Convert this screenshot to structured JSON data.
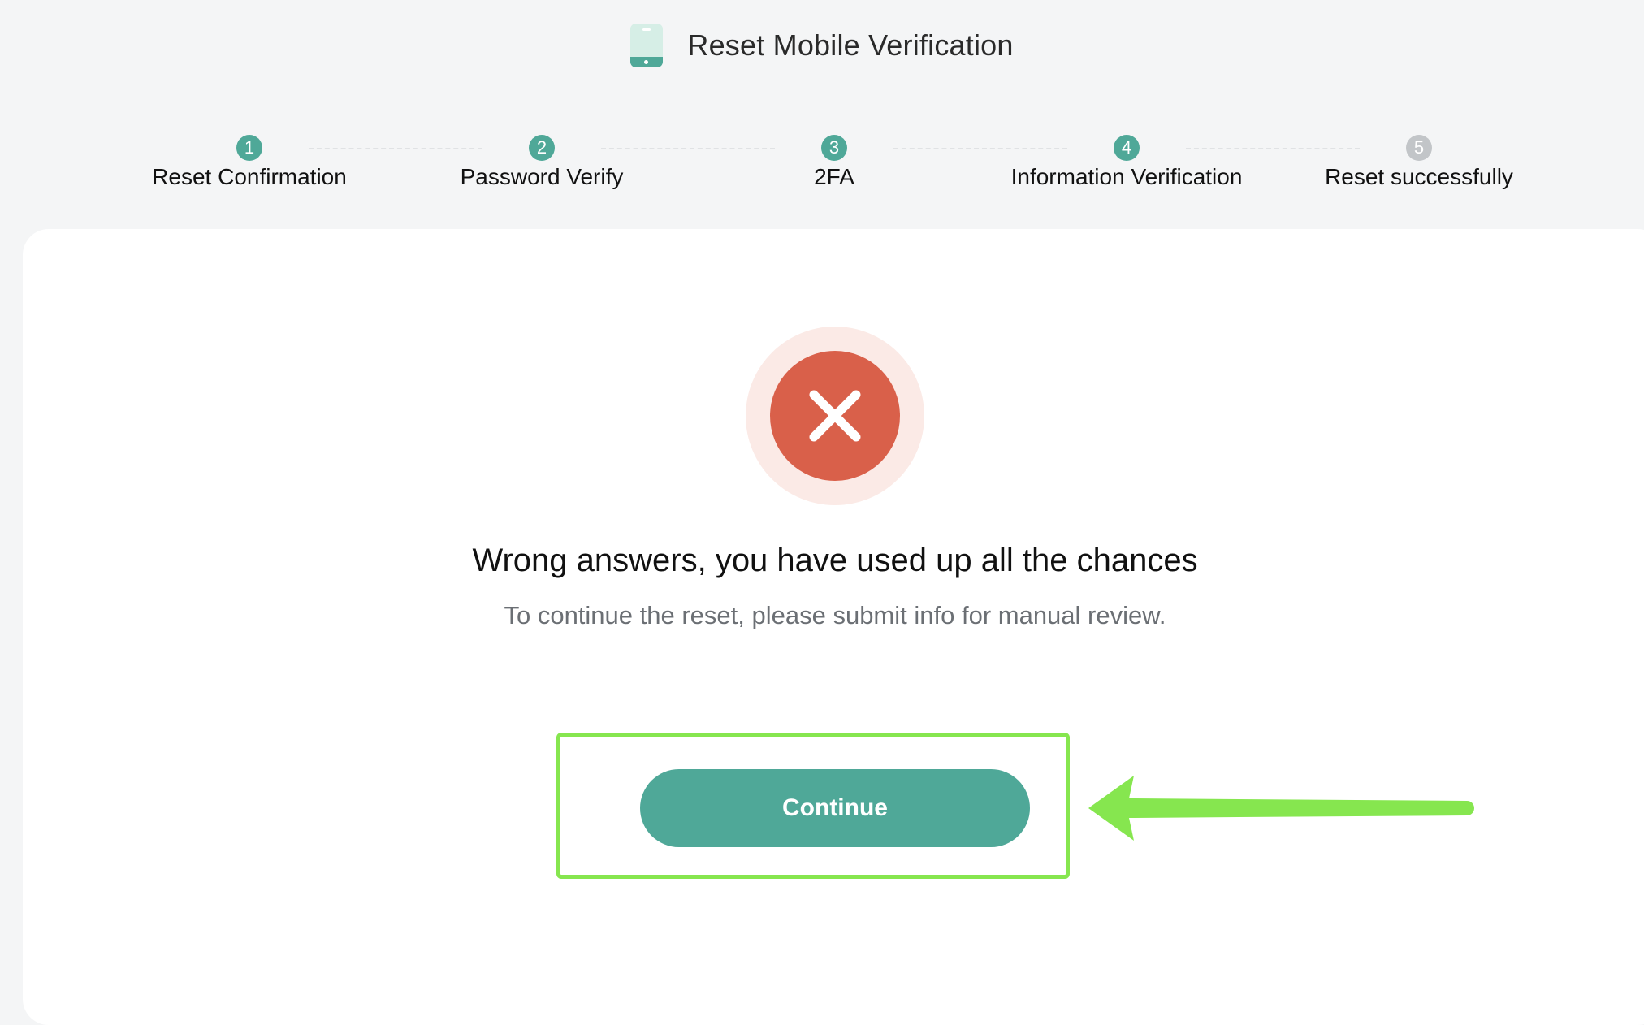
{
  "header": {
    "title": "Reset Mobile Verification",
    "icon": "phone-icon"
  },
  "stepper": {
    "current_step": 4,
    "steps": [
      {
        "number": "1",
        "label": "Reset Confirmation",
        "state": "completed"
      },
      {
        "number": "2",
        "label": "Password Verify",
        "state": "completed"
      },
      {
        "number": "3",
        "label": "2FA",
        "state": "completed"
      },
      {
        "number": "4",
        "label": "Information Verification",
        "state": "active"
      },
      {
        "number": "5",
        "label": "Reset successfully",
        "state": "pending"
      }
    ]
  },
  "result": {
    "icon": "error-x-icon",
    "title": "Wrong answers, you have used up all the chances",
    "subtitle": "To continue the reset, please submit info for manual review."
  },
  "actions": {
    "continue_label": "Continue"
  },
  "colors": {
    "brand": "#4fa898",
    "error": "#d9604a",
    "error_halo": "#fbeae6",
    "pending": "#c2c5c8",
    "annotation": "#86e64f",
    "background": "#f4f5f6"
  }
}
